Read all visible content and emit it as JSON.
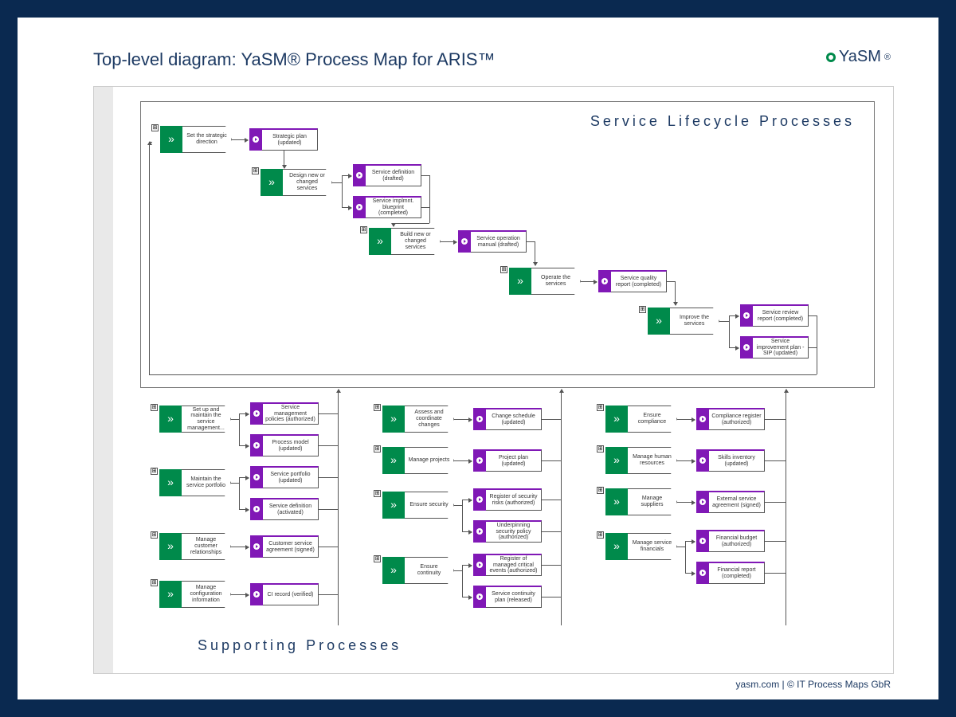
{
  "title": "Top-level diagram: YaSM® Process Map for ARIS™",
  "brand": "YaSM",
  "brand_suffix": "®",
  "footer": "yasm.com | © IT Process Maps GbR",
  "sections": {
    "lifecycle_title": "Service Lifecycle Processes",
    "supporting_title": "Supporting Processes"
  },
  "lifecycle": {
    "p1": {
      "label": "Set the strategic direction"
    },
    "d1": {
      "label": "Strategic plan (updated)"
    },
    "p2": {
      "label": "Design new or changed services"
    },
    "d2a": {
      "label": "Service definition (drafted)"
    },
    "d2b": {
      "label": "Service implmnt. blueprint (completed)"
    },
    "p3": {
      "label": "Build new or changed services"
    },
    "d3": {
      "label": "Service operation manual (drafted)"
    },
    "p4": {
      "label": "Operate the services"
    },
    "d4": {
      "label": "Service quality report (completed)"
    },
    "p5": {
      "label": "Improve the services"
    },
    "d5a": {
      "label": "Service review report (completed)"
    },
    "d5b": {
      "label": "Service improvement plan - SIP (updated)"
    }
  },
  "supporting": {
    "col1": {
      "p1": "Set up and maintain the service management...",
      "d1a": "Service management policies (authorized)",
      "d1b": "Process model (updated)",
      "p2": "Maintain the service portfolio",
      "d2a": "Service portfolio (updated)",
      "d2b": "Service definition (activated)",
      "p3": "Manage customer relationships",
      "d3": "Customer service agreement (signed)",
      "p4": "Manage configuration information",
      "d4": "CI record (verified)"
    },
    "col2": {
      "p1": "Assess and coordinate changes",
      "d1": "Change schedule (updated)",
      "p2": "Manage projects",
      "d2": "Project plan (updated)",
      "p3": "Ensure security",
      "d3a": "Register of security risks (authorized)",
      "d3b": "Underpinning security policy (authorized)",
      "p4": "Ensure continuity",
      "d4a": "Register of managed critical events (authorized)",
      "d4b": "Service continuity plan (released)"
    },
    "col3": {
      "p1": "Ensure compliance",
      "d1": "Compliance register (authorized)",
      "p2": "Manage human resources",
      "d2": "Skills inventory (updated)",
      "p3": "Manage suppliers",
      "d3": "External service agreement (signed)",
      "p4": "Manage service financials",
      "d4a": "Financial budget (authorized)",
      "d4b": "Financial report (completed)"
    }
  }
}
